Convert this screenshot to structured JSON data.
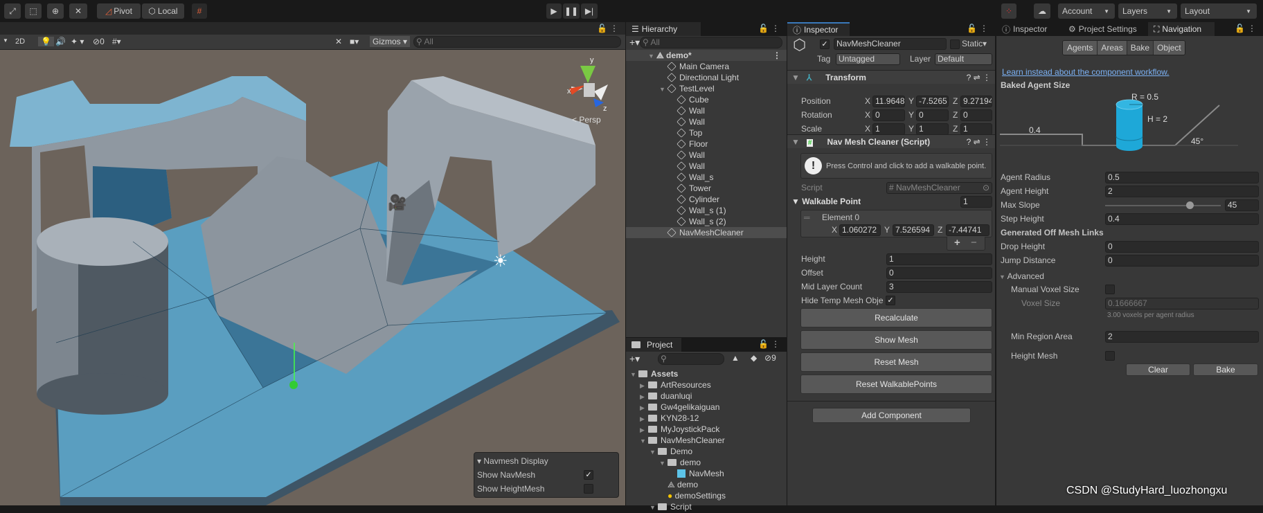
{
  "toolbar": {
    "pivot": "Pivot",
    "local": "Local",
    "account": "Account",
    "layers": "Layers",
    "layout": "Layout",
    "icons": [
      "move-icon",
      "rect-tool-icon",
      "transform-icon",
      "custom-tool-icon",
      "grid-snap-icon",
      "play-icon",
      "pause-icon",
      "step-icon",
      "collab-icon",
      "cloud-icon"
    ]
  },
  "scene": {
    "mode_2d": "2D",
    "hidden_count": "0",
    "gizmos": "Gizmos",
    "search_placeholder": "All",
    "persp": "Persp",
    "axis_x": "x",
    "axis_y": "y",
    "axis_z": "z",
    "navmesh_display": {
      "title": "Navmesh Display",
      "show_navmesh": "Show NavMesh",
      "show_navmesh_checked": true,
      "show_heightmesh": "Show HeightMesh",
      "show_heightmesh_checked": false
    }
  },
  "hierarchy": {
    "tab": "Hierarchy",
    "search_placeholder": "All",
    "scene": "demo*",
    "items": [
      {
        "label": "Main Camera",
        "depth": 1
      },
      {
        "label": "Directional Light",
        "depth": 1
      },
      {
        "label": "TestLevel",
        "depth": 1,
        "expanded": true
      },
      {
        "label": "Cube",
        "depth": 2
      },
      {
        "label": "Wall",
        "depth": 2
      },
      {
        "label": "Wall",
        "depth": 2
      },
      {
        "label": "Top",
        "depth": 2
      },
      {
        "label": "Floor",
        "depth": 2
      },
      {
        "label": "Wall",
        "depth": 2
      },
      {
        "label": "Wall",
        "depth": 2
      },
      {
        "label": "Wall_s",
        "depth": 2
      },
      {
        "label": "Tower",
        "depth": 2
      },
      {
        "label": "Cylinder",
        "depth": 2
      },
      {
        "label": "Wall_s (1)",
        "depth": 2
      },
      {
        "label": "Wall_s (2)",
        "depth": 2
      },
      {
        "label": "NavMeshCleaner",
        "depth": 1,
        "selected": true
      }
    ]
  },
  "project": {
    "tab": "Project",
    "hidden_count": "9",
    "items": [
      {
        "label": "Assets",
        "depth": 0
      },
      {
        "label": "ArtResources",
        "depth": 1
      },
      {
        "label": "duanluqi",
        "depth": 1
      },
      {
        "label": "Gw4gelikaiguan",
        "depth": 1
      },
      {
        "label": "KYN28-12",
        "depth": 1
      },
      {
        "label": "MyJoystickPack",
        "depth": 1
      },
      {
        "label": "NavMeshCleaner",
        "depth": 1
      },
      {
        "label": "Demo",
        "depth": 2
      },
      {
        "label": "demo",
        "depth": 3
      },
      {
        "label": "NavMesh",
        "depth": 4
      },
      {
        "label": "demo",
        "depth": 3
      },
      {
        "label": "demoSettings",
        "depth": 3
      },
      {
        "label": "Script",
        "depth": 2
      }
    ]
  },
  "inspector": {
    "tab": "Inspector",
    "object_name": "NavMeshCleaner",
    "active": true,
    "static": "Static",
    "tag_label": "Tag",
    "tag": "Untagged",
    "layer_label": "Layer",
    "layer": "Default",
    "transform": {
      "title": "Transform",
      "rows": [
        {
          "label": "Position",
          "x": "11.9648",
          "y": "-7.5265",
          "z": "9.27194"
        },
        {
          "label": "Rotation",
          "x": "0",
          "y": "0",
          "z": "0"
        },
        {
          "label": "Scale",
          "x": "1",
          "y": "1",
          "z": "1"
        }
      ]
    },
    "script": {
      "title": "Nav Mesh Cleaner (Script)",
      "help": "Press Control and click to add a walkable point.",
      "script_label": "Script",
      "script_value": "NavMeshCleaner",
      "walkable_label": "Walkable Point",
      "walkable_size": "1",
      "element_label": "Element 0",
      "ex": "1.060272",
      "ey": "7.526594",
      "ez": "-7.44741",
      "height_label": "Height",
      "height": "1",
      "offset_label": "Offset",
      "offset": "0",
      "mid_label": "Mid Layer Count",
      "mid": "3",
      "hide_label": "Hide Temp Mesh Obje",
      "hide_checked": true,
      "buttons": [
        "Recalculate",
        "Show Mesh",
        "Reset Mesh",
        "Reset WalkablePoints"
      ]
    },
    "add_component": "Add Component",
    "axis": {
      "x": "X",
      "y": "Y",
      "z": "Z"
    }
  },
  "navigation": {
    "tabs": [
      "Inspector",
      "Project Settings",
      "Navigation"
    ],
    "subtabs": [
      "Agents",
      "Areas",
      "Bake",
      "Object"
    ],
    "active_subtab": "Bake",
    "link": "Learn instead about the component workflow.",
    "baked_agent_size": "Baked Agent Size",
    "diagram": {
      "radius": "R = 0.5",
      "height": "H = 2",
      "step": "0.4",
      "slope": "45°"
    },
    "fields": [
      {
        "label": "Agent Radius",
        "value": "0.5"
      },
      {
        "label": "Agent Height",
        "value": "2"
      },
      {
        "label": "Max Slope",
        "value": "45"
      },
      {
        "label": "Step Height",
        "value": "0.4"
      }
    ],
    "max_slope_fraction": 0.73,
    "offmesh_title": "Generated Off Mesh Links",
    "drop_label": "Drop Height",
    "drop": "0",
    "jump_label": "Jump Distance",
    "jump": "0",
    "advanced": "Advanced",
    "manual_voxel": "Manual Voxel Size",
    "manual_voxel_checked": false,
    "voxel_size_label": "Voxel Size",
    "voxel_size": "0.1666667",
    "voxel_note": "3.00 voxels per agent radius",
    "min_region_label": "Min Region Area",
    "min_region": "2",
    "height_mesh": "Height Mesh",
    "height_mesh_checked": false,
    "clear": "Clear",
    "bake": "Bake",
    "agent_color": "#1ea8d8"
  },
  "watermark": "CSDN @StudyHard_luozhongxu"
}
